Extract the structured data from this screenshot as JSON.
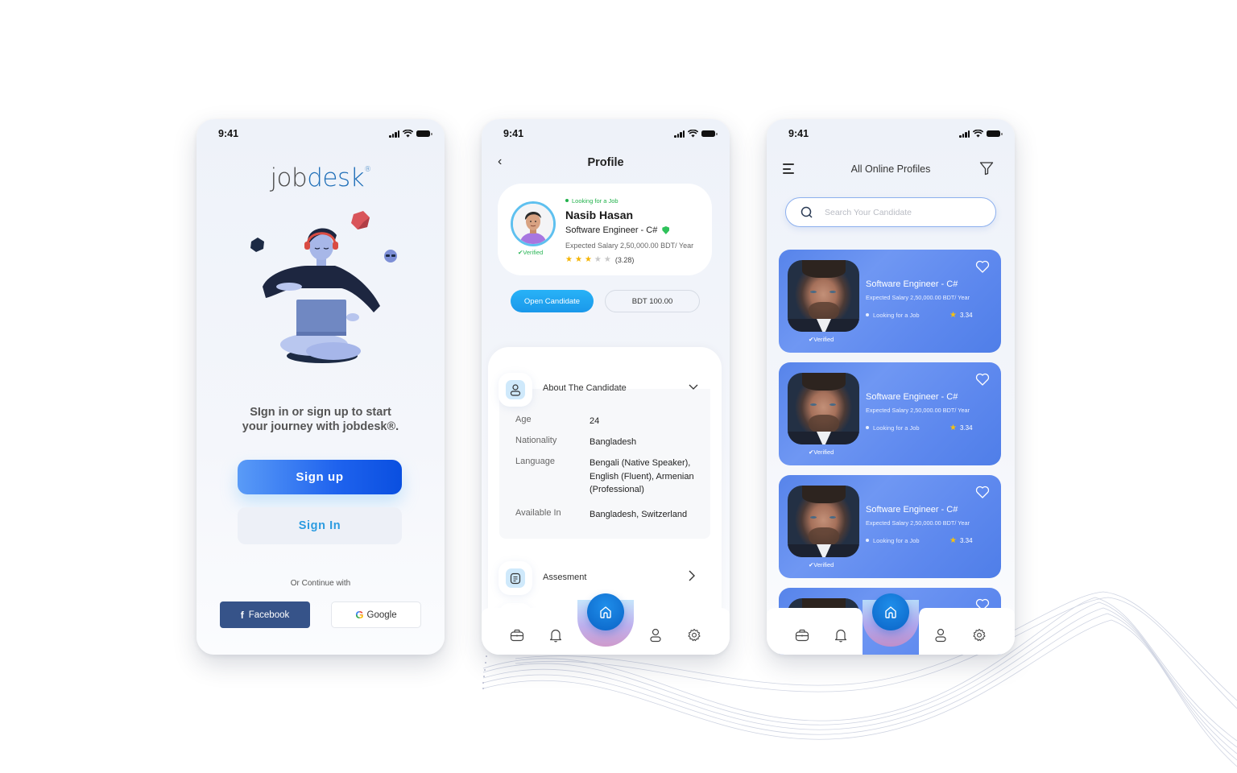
{
  "status_bar": {
    "time": "9:41"
  },
  "signin_screen": {
    "logo_part1": "job",
    "logo_part2": "desk",
    "logo_mark": "®",
    "tagline_line1": "SIgn in or sign up to start",
    "tagline_line2": "your journey with  jobdesk®.",
    "signup_label": "Sign up",
    "signin_label": "Sign In",
    "or_continue": "Or Continue with",
    "facebook_label": "Facebook",
    "google_label": "Google",
    "facebook_icon": "f",
    "google_icon": "G"
  },
  "profile_screen": {
    "title": "Profile",
    "back_icon": "‹",
    "status": "Looking for a Job",
    "name": "Nasib Hasan",
    "role": "Software Engineer - C#",
    "verified": "✔Verified",
    "salary": "Expected Salary 2,50,000.00 BDT/ Year",
    "rating": 3.28,
    "rating_label": "(3.28)",
    "stars_filled": 3,
    "stars_total": 5,
    "open_candidate_label": "Open Candidate",
    "price_label": "BDT 100.00",
    "about_section": {
      "label": "About The Candidate",
      "rows": [
        {
          "key": "Age",
          "value": "24"
        },
        {
          "key": "Nationality",
          "value": "Bangladesh"
        },
        {
          "key": "Language",
          "value": "Bengali (Native Speaker), English (Fluent), Armenian (Professional)"
        },
        {
          "key": "Available In",
          "value": "Bangladesh, Switzerland"
        }
      ]
    },
    "assessment_label": "Assesment"
  },
  "profiles_screen": {
    "title": "All Online Profiles",
    "search_placeholder": "Search Your Candidate",
    "cards": [
      {
        "role": "Software Engineer - C#",
        "salary": "Expected Salary 2,50,000.00 BDT/ Year",
        "status": "Looking for a Job",
        "rating": "3.34",
        "verified": "✔Verified"
      },
      {
        "role": "Software Engineer - C#",
        "salary": "Expected Salary 2,50,000.00 BDT/ Year",
        "status": "Looking for a Job",
        "rating": "3.34",
        "verified": "✔Verified"
      },
      {
        "role": "Software Engineer - C#",
        "salary": "Expected Salary 2,50,000.00 BDT/ Year",
        "status": "Looking for a Job",
        "rating": "3.34",
        "verified": "✔Verified"
      }
    ]
  },
  "bottom_nav": {
    "items": [
      "briefcase-icon",
      "bell-icon",
      "home-icon",
      "user-icon",
      "settings-icon"
    ],
    "active": "home-icon"
  },
  "colors": {
    "brand_blue": "#1f6fb8",
    "primary_button": "#1f63ee",
    "accent_cyan": "#1a98ea",
    "success_green": "#22b24c",
    "card_blue": "#5d88ee",
    "facebook": "#365389",
    "star": "#f5b400"
  }
}
